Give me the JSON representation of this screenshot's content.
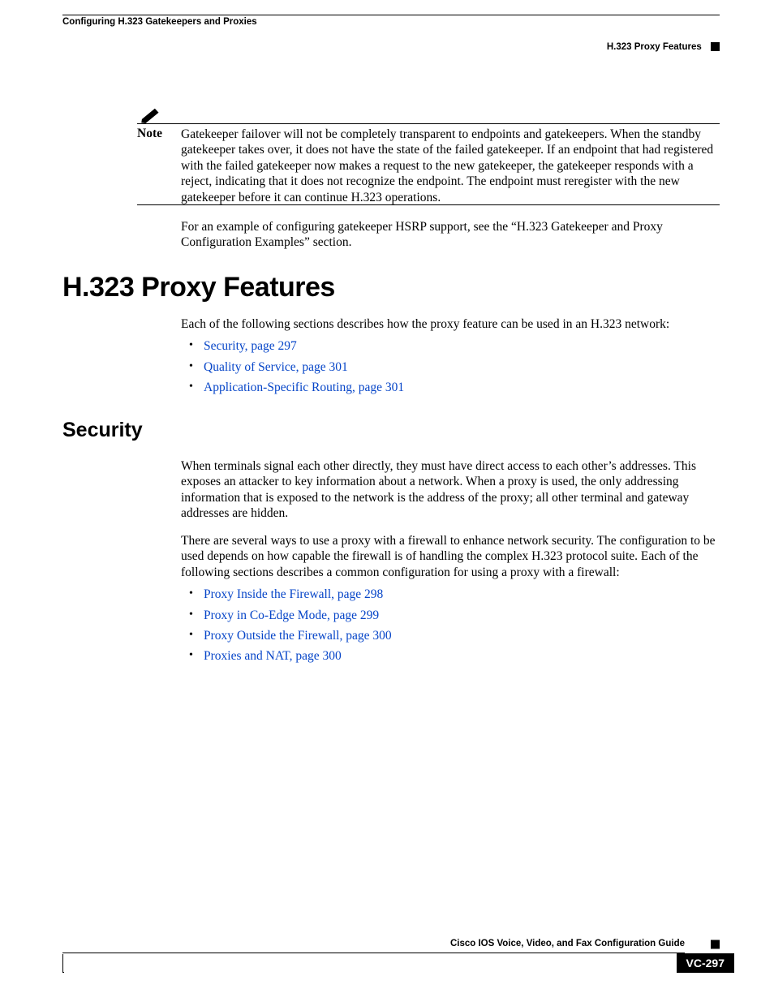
{
  "running_head": {
    "left": "Configuring H.323 Gatekeepers and Proxies",
    "right": "H.323 Proxy Features"
  },
  "note": {
    "label": "Note",
    "text": "Gatekeeper failover will not be completely transparent to endpoints and gatekeepers. When the standby gatekeeper takes over, it does not have the state of the failed gatekeeper. If an endpoint that had registered with the failed gatekeeper now makes a request to the new gatekeeper, the gatekeeper responds with a reject, indicating that it does not recognize the endpoint. The endpoint must reregister with the new gatekeeper before it can continue H.323 operations."
  },
  "para_after_note": "For an example of configuring gatekeeper HSRP support, see the “H.323 Gatekeeper and Proxy Configuration Examples” section.",
  "h1": "H.323 Proxy Features",
  "intro1": "Each of the following sections describes how the proxy feature can be used in an H.323 network:",
  "links1": [
    "Security, page 297",
    "Quality of Service, page 301",
    "Application-Specific Routing, page 301"
  ],
  "h2": "Security",
  "secpara1": "When terminals signal each other directly, they must have direct access to each other’s addresses. This exposes an attacker to key information about a network. When a proxy is used, the only addressing information that is exposed to the network is the address of the proxy; all other terminal and gateway addresses are hidden.",
  "secpara2": "There are several ways to use a proxy with a firewall to enhance network security. The configuration to be used depends on how capable the firewall is of handling the complex H.323 protocol suite. Each of the following sections describes a common configuration for using a proxy with a firewall:",
  "links2": [
    "Proxy Inside the Firewall, page 298",
    "Proxy in Co-Edge Mode, page 299",
    "Proxy Outside the Firewall, page 300",
    "Proxies and NAT, page 300"
  ],
  "footer": {
    "guide": "Cisco IOS Voice, Video, and Fax Configuration Guide",
    "page": "VC-297"
  }
}
